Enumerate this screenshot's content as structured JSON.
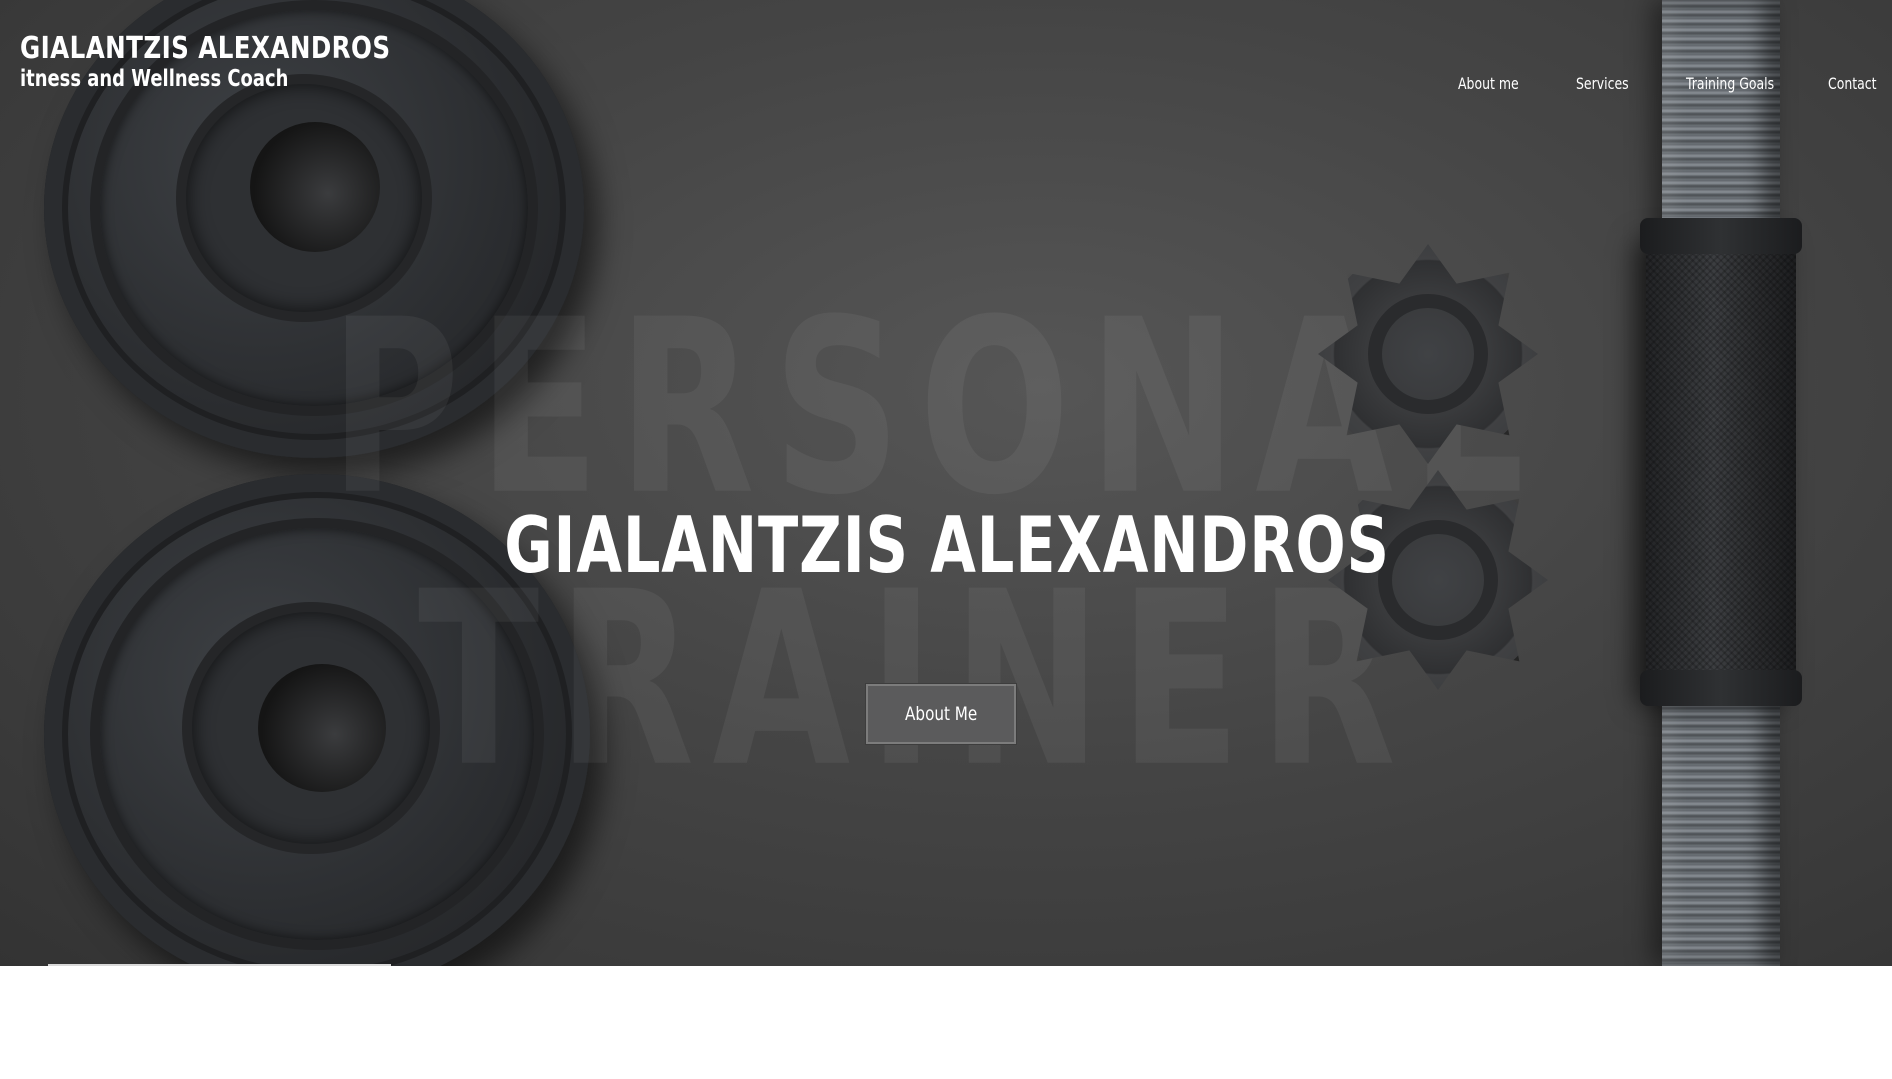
{
  "header": {
    "brand_name": "GIALANTZIS ALEXANDROS",
    "brand_tagline": "itness and Wellness Coach"
  },
  "nav": {
    "items": [
      {
        "label": "About me"
      },
      {
        "label": "Services"
      },
      {
        "label": "Training Goals"
      },
      {
        "label": "Contact"
      }
    ]
  },
  "hero": {
    "background_words": [
      "PERSONAL",
      "TRAINER"
    ],
    "title": "GIALANTZIS ALEXANDROS",
    "button_label": "About Me"
  },
  "colors": {
    "hero_background": "#474747",
    "button_background": "#5b5b5c",
    "text": "#ffffff"
  }
}
